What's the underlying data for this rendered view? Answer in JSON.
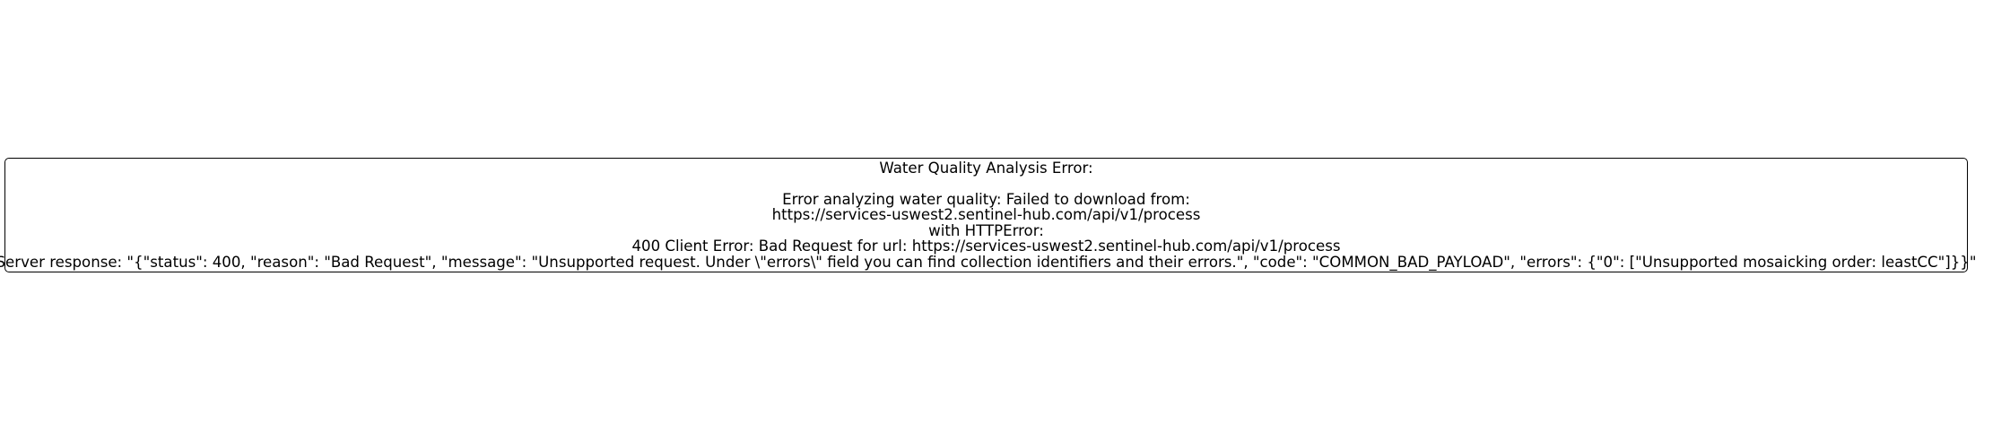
{
  "error_panel": {
    "title": "Water Quality Analysis Error:",
    "line_1": "Error analyzing water quality: Failed to download from:",
    "line_2": "https://services-uswest2.sentinel-hub.com/api/v1/process",
    "line_3": "with HTTPError:",
    "line_4": "400 Client Error: Bad Request for url: https://services-uswest2.sentinel-hub.com/api/v1/process",
    "line_5": "Server response: \"{\"status\": 400, \"reason\": \"Bad Request\", \"message\": \"Unsupported request. Under \\\"errors\\\" field you can find collection identifiers and their errors.\", \"code\": \"COMMON_BAD_PAYLOAD\", \"errors\": {\"0\": [\"Unsupported mosaicking order: leastCC\"]}}\""
  }
}
